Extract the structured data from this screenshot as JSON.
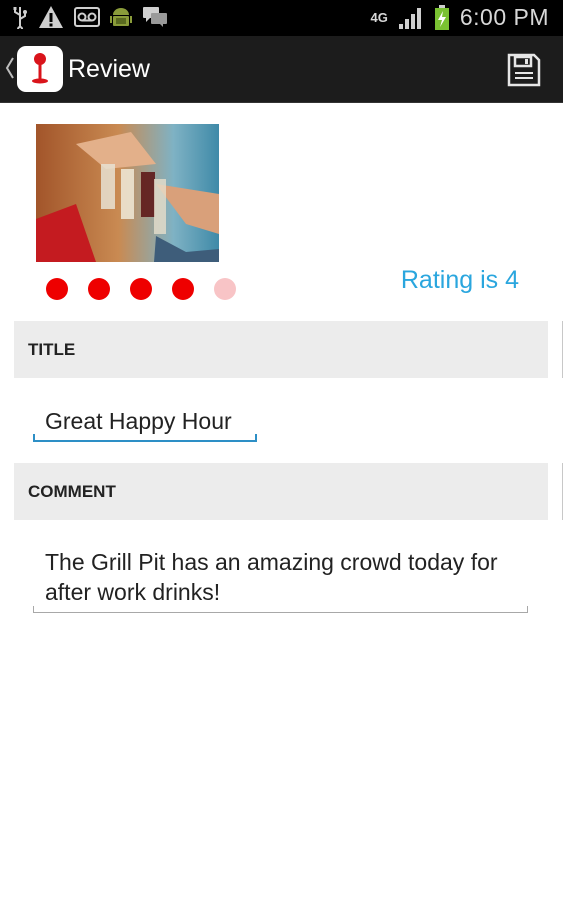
{
  "status_bar": {
    "left_icons": [
      "usb-icon",
      "warning-icon",
      "voicemail-icon",
      "android-icon",
      "chat-icon"
    ],
    "network": "4G",
    "time": "6:00 PM"
  },
  "action_bar": {
    "title": "Review",
    "app_icon": "wine-glass-icon",
    "save_icon": "save-icon"
  },
  "review": {
    "rating": {
      "value": 4,
      "max": 5,
      "text": "Rating is 4",
      "color_on": "#ee0000",
      "color_off": "#f8c4c6"
    },
    "title_section": {
      "header": "TITLE",
      "value": "Great Happy Hour"
    },
    "comment_section": {
      "header": "COMMENT",
      "value": "The Grill Pit has an amazing crowd today for after work drinks!"
    }
  },
  "colors": {
    "accent": "#2aa6de",
    "input_focus": "#2d8fc6",
    "action_bar": "#1c1c1c"
  }
}
